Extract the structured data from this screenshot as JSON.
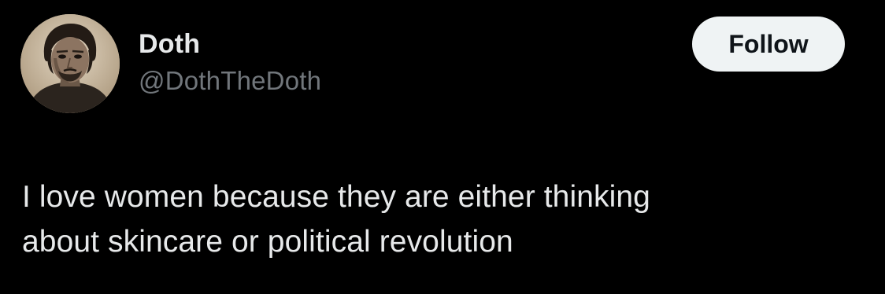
{
  "author": {
    "display_name": "Doth",
    "handle": "@DothTheDoth"
  },
  "follow_button": {
    "label": "Follow"
  },
  "tweet": {
    "text_lines": [
      "I love women because they are either thinking",
      "about skincare or political revolution"
    ]
  },
  "icons": {
    "avatar": "profile-portrait-avatar"
  },
  "colors": {
    "background": "#000000",
    "primary_text": "#e7e9ea",
    "secondary_text": "#71767b",
    "button_bg": "#eff3f4",
    "button_text": "#0f1419"
  }
}
